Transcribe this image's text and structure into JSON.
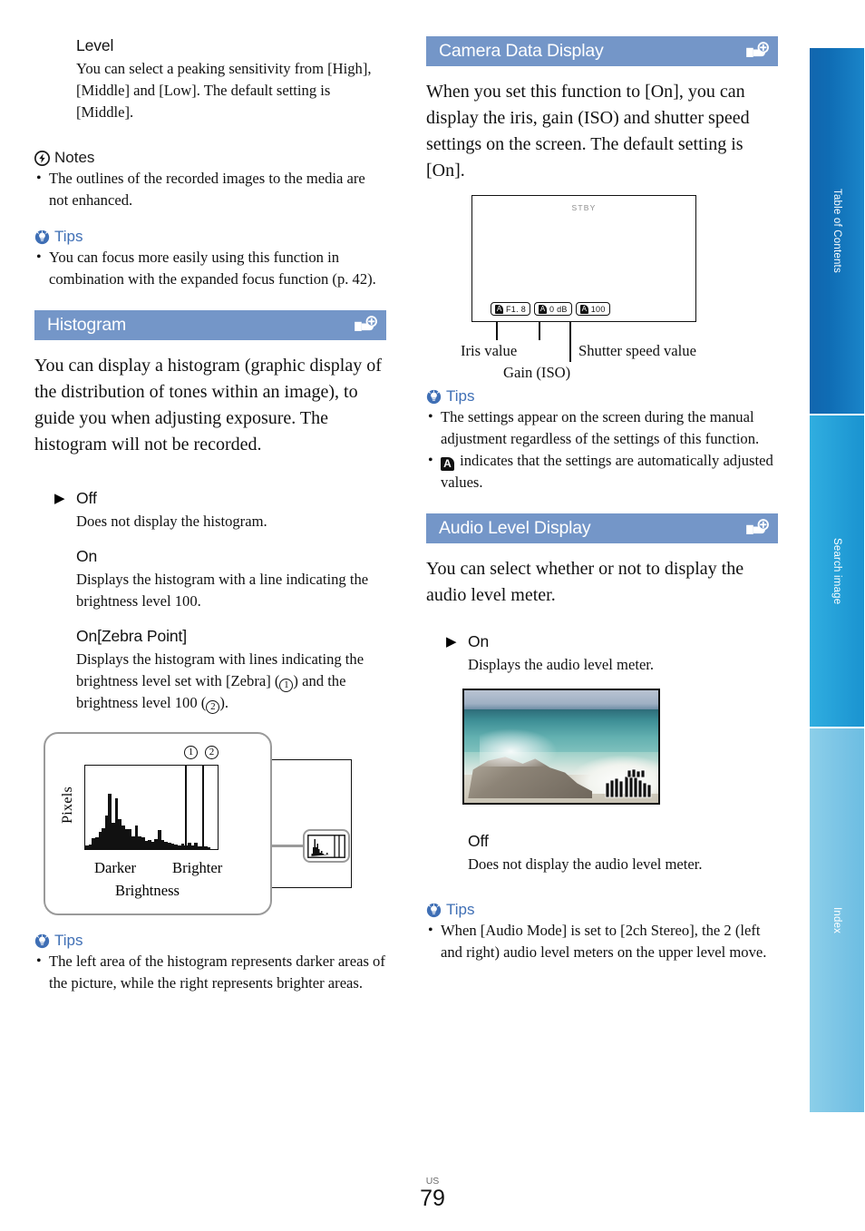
{
  "page": {
    "locale": "US",
    "number": "79"
  },
  "section_icon_name": "menu-card-plus-icon",
  "colors": {
    "section_bar": "#7496c8",
    "tips_text": "#3f6fb5",
    "tab_toc": "#0f6cb4",
    "tab_search": "#27a3da",
    "tab_index": "#7ec6e6"
  },
  "left_column": {
    "level": {
      "heading": "Level",
      "body": "You can select a peaking sensitivity from [High], [Middle] and [Low]. The default setting is [Middle]."
    },
    "notes": {
      "label": "Notes",
      "items": [
        "The outlines of the recorded images to the media are not enhanced."
      ]
    },
    "tips_peaking": {
      "label": "Tips",
      "items": [
        "You can focus more easily using this function in combination with the expanded focus function (p. 42)."
      ]
    },
    "histogram_section": {
      "title": "Histogram",
      "intro": "You can display a histogram (graphic display of the distribution of tones within an image), to guide you when adjusting exposure. The histogram will not be recorded.",
      "options": [
        {
          "selected": true,
          "name": "Off",
          "desc": "Does not display the histogram."
        },
        {
          "selected": false,
          "name": "On",
          "desc": "Displays the histogram with a line indicating the brightness level 100."
        },
        {
          "selected": false,
          "name": "On[Zebra Point]",
          "desc_pre": "Displays the histogram with lines indicating the brightness level set with [Zebra] (",
          "desc_mid": ") and the brightness level 100 (",
          "desc_post": ").",
          "marker1": "1",
          "marker2": "2"
        }
      ],
      "figure": {
        "marker1": "1",
        "marker2": "2",
        "y_axis_label": "Pixels",
        "x_left_label": "Darker",
        "x_right_label": "Brighter",
        "x_axis_label": "Brightness"
      }
    },
    "tips_histogram": {
      "label": "Tips",
      "items": [
        "The left area of the histogram represents darker areas of the picture, while the right represents brighter areas."
      ]
    }
  },
  "right_column": {
    "camera_data_section": {
      "title": "Camera Data Display",
      "intro": "When you set this function to [On], you can display the iris, gain (ISO) and shutter speed settings on the screen. The default setting is [On].",
      "screen": {
        "status_text": "STBY",
        "badges": [
          {
            "auto_icon": "A",
            "value": "F1. 8"
          },
          {
            "auto_icon": "A",
            "value": "0 dB"
          },
          {
            "auto_icon": "A",
            "value": "100"
          }
        ]
      },
      "callouts": {
        "iris": "Iris value",
        "shutter": "Shutter speed value",
        "gain": "Gain (ISO)"
      },
      "tips": {
        "label": "Tips",
        "items": [
          {
            "text": "The settings appear on the screen during the manual adjustment regardless of the settings of this function.",
            "icon": null
          },
          {
            "text": " indicates that the settings are automatically adjusted values.",
            "icon": "A"
          }
        ]
      }
    },
    "audio_level_section": {
      "title": "Audio Level Display",
      "intro": "You can select whether or not to display the audio level meter.",
      "options": [
        {
          "selected": true,
          "name": "On",
          "desc": "Displays the audio level meter."
        },
        {
          "selected": false,
          "name": "Off",
          "desc": "Does not display the audio level meter."
        }
      ],
      "photo_alt": "coastal rocks with breaking waves and audio level meter overlay",
      "tips": {
        "label": "Tips",
        "items": [
          "When [Audio Mode] is set to [2ch Stereo], the 2 (left and right) audio level meters on the upper level move."
        ]
      }
    }
  },
  "sidebar_tabs": [
    {
      "label": "Table of Contents"
    },
    {
      "label": "Search image"
    },
    {
      "label": "Index"
    }
  ],
  "chart_data": {
    "type": "bar",
    "title": "Histogram",
    "xlabel": "Brightness",
    "ylabel": "Pixels",
    "x_tick_labels": [
      "Darker",
      "Brighter"
    ],
    "grid": false,
    "legend": false,
    "categories": [
      "0",
      "1",
      "2",
      "3",
      "4",
      "5",
      "6",
      "7",
      "8",
      "9",
      "10",
      "11",
      "12",
      "13",
      "14",
      "15",
      "16",
      "17",
      "18",
      "19",
      "20",
      "21",
      "22",
      "23",
      "24",
      "25",
      "26",
      "27",
      "28",
      "29",
      "30",
      "31",
      "32",
      "33",
      "34",
      "35",
      "36",
      "37",
      "38",
      "39"
    ],
    "values": [
      4,
      5,
      12,
      13,
      19,
      24,
      38,
      62,
      30,
      57,
      34,
      27,
      23,
      22,
      14,
      27,
      14,
      13,
      9,
      10,
      8,
      11,
      21,
      10,
      8,
      7,
      6,
      5,
      4,
      6,
      4,
      7,
      4,
      7,
      3,
      3,
      3,
      2,
      0,
      0
    ],
    "ylim": [
      0,
      94
    ],
    "annotations": [
      {
        "label": "1",
        "type": "vline",
        "x_fraction": 0.755
      },
      {
        "label": "2",
        "type": "vline",
        "x_fraction": 0.885
      }
    ]
  }
}
